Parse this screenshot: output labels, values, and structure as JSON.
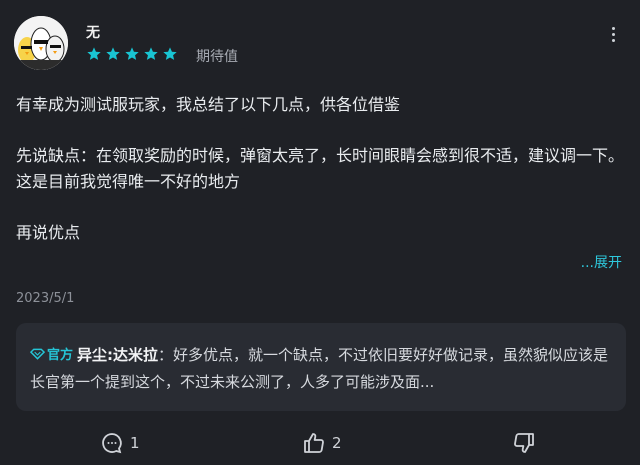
{
  "review": {
    "username": "无",
    "rating": 5,
    "rating_label": "期待值",
    "paragraphs": [
      "有幸成为测试服玩家，我总结了以下几点，供各位借鉴",
      "先说缺点：在领取奖励的时候，弹窗太亮了，长时间眼睛会感到很不适，建议调一下。这是目前我觉得唯一不好的地方",
      "再说优点"
    ],
    "expand_label": "...展开",
    "date": "2023/5/1"
  },
  "official_reply": {
    "badge": "官方",
    "name": "异尘:达米拉",
    "separator": "：",
    "text": "好多优点，就一个缺点，不过依旧要好好做记录，虽然貌似应该是长官第一个提到这个，不过未来公测了，人多了可能涉及面..."
  },
  "actions": {
    "comment_count": "1",
    "like_count": "2"
  },
  "colors": {
    "accent": "#19c5d3",
    "background": "#1f2126",
    "reply_background": "#292c33"
  },
  "icons": [
    "avatar",
    "star-icon",
    "more-icon",
    "official-badge-icon",
    "comment-icon",
    "thumbs-up-icon",
    "thumbs-down-icon"
  ]
}
